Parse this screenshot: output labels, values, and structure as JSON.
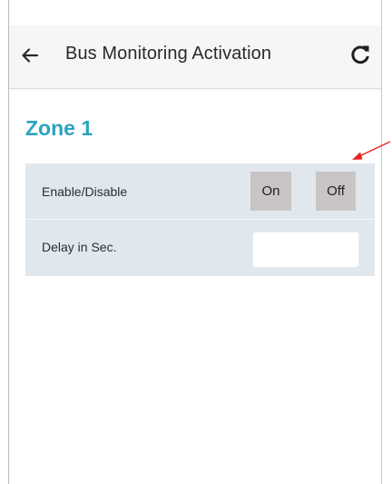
{
  "appbar": {
    "title": "Bus Monitoring Activation",
    "back_icon": "arrow-left-icon",
    "refresh_icon": "refresh-icon"
  },
  "zone": {
    "title": "Zone 1"
  },
  "settings": {
    "enable_label": "Enable/Disable",
    "on_label": "On",
    "off_label": "Off",
    "delay_label": "Delay in Sec.",
    "delay_value": ""
  },
  "colors": {
    "zone_title": "#2aa3bf",
    "card_bg": "#e0e8ee",
    "toggle_bg": "#c9c5c5",
    "annotation": "#e8231f"
  }
}
